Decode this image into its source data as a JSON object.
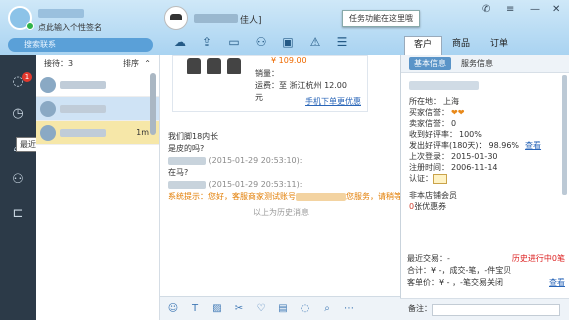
{
  "profile": {
    "signature": "点此输入个性签名"
  },
  "search": {
    "placeholder": "搜索联系"
  },
  "chat": {
    "name_suffix": "佳人]",
    "tooltip": "任务功能在这里哦"
  },
  "right_tabs": [
    "客户",
    "商品",
    "订单"
  ],
  "left_rail": {
    "badge": "1",
    "tooltip": "最近联系"
  },
  "contacts": {
    "header": "接待：3",
    "sort_label": "排序",
    "items": [
      {
        "time": ""
      },
      {
        "time": ""
      },
      {
        "time": "1m"
      }
    ]
  },
  "product": {
    "price": "¥ 109.00",
    "sales_label": "销量：",
    "ship_label": "运费：",
    "ship_value": "至 浙江杭州 12.00 元",
    "mobile_order": "手机下单更优惠"
  },
  "messages": [
    {
      "text": "我们脚18内长"
    },
    {
      "text": "是皮的吗?"
    },
    {
      "time": "(2015-01-29 20:53:10):"
    },
    {
      "text": "在马?"
    },
    {
      "time": "(2015-01-29 20:53:11):"
    },
    {
      "sys_prefix": "系统提示：您好，客服商家测试账号",
      "sys_suffix": "您服务，请稍等"
    }
  ],
  "divider": "以上为历史消息",
  "right_panel": {
    "tabs": [
      "基本信息",
      "服务信息"
    ],
    "info": [
      {
        "label": "所在地：",
        "value": "上海"
      },
      {
        "label": "买家信誉：",
        "value": "❤❤"
      },
      {
        "label": "卖家信誉：",
        "value": "0"
      },
      {
        "label": "收到好评率：",
        "value": "100%"
      },
      {
        "label": "发出好评率(180天)：",
        "value": "98.96%",
        "link": "查看"
      },
      {
        "label": "上次登录：",
        "value": "2015-01-30"
      },
      {
        "label": "注册时间：",
        "value": "2006-11-14"
      },
      {
        "label": "认证：",
        "value": ""
      }
    ],
    "member_title": "非本店铺会员",
    "coupon_count": "0",
    "coupon_label": "张优惠券",
    "recent_label": "最近交易：",
    "recent_value": "-",
    "history_label": "进行中",
    "history_count": "0",
    "history_unit": "笔",
    "history_prefix": "历史",
    "total_label": "合计：",
    "total_value": "¥ -，成交-笔，-件宝贝",
    "refund_label": "客单价：",
    "refund_value": "¥ - ，-笔交易关闭",
    "refund_link": "查看",
    "notes_label": "备注："
  }
}
